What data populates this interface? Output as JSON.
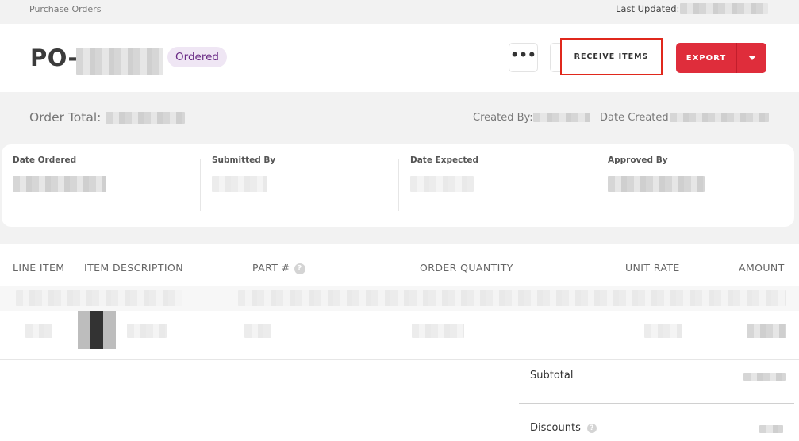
{
  "breadcrumb": "Purchase Orders",
  "last_updated_label": "Last Updated:",
  "po": {
    "title_prefix": "PO-",
    "status": "Ordered",
    "more_label": "•••"
  },
  "actions": {
    "receive_items": "RECEIVE ITEMS",
    "export": "EXPORT"
  },
  "summary_row": {
    "order_total_label": "Order Total:",
    "created_by_label": "Created By:",
    "date_created_label": "Date Created:"
  },
  "details": [
    {
      "label": "Date Ordered"
    },
    {
      "label": "Submitted By"
    },
    {
      "label": "Date Expected"
    },
    {
      "label": "Approved By"
    }
  ],
  "table": {
    "columns": [
      "LINE ITEM",
      "ITEM DESCRIPTION",
      "PART #",
      "ORDER QUANTITY",
      "UNIT RATE",
      "AMOUNT"
    ],
    "help_icon": "?"
  },
  "totals": {
    "subtotal_label": "Subtotal",
    "discounts_label": "Discounts"
  },
  "colors": {
    "accent_red": "#df2d3b",
    "badge_bg": "#efe6f4",
    "badge_text": "#6a2b86",
    "highlight_border": "#e0281c"
  }
}
